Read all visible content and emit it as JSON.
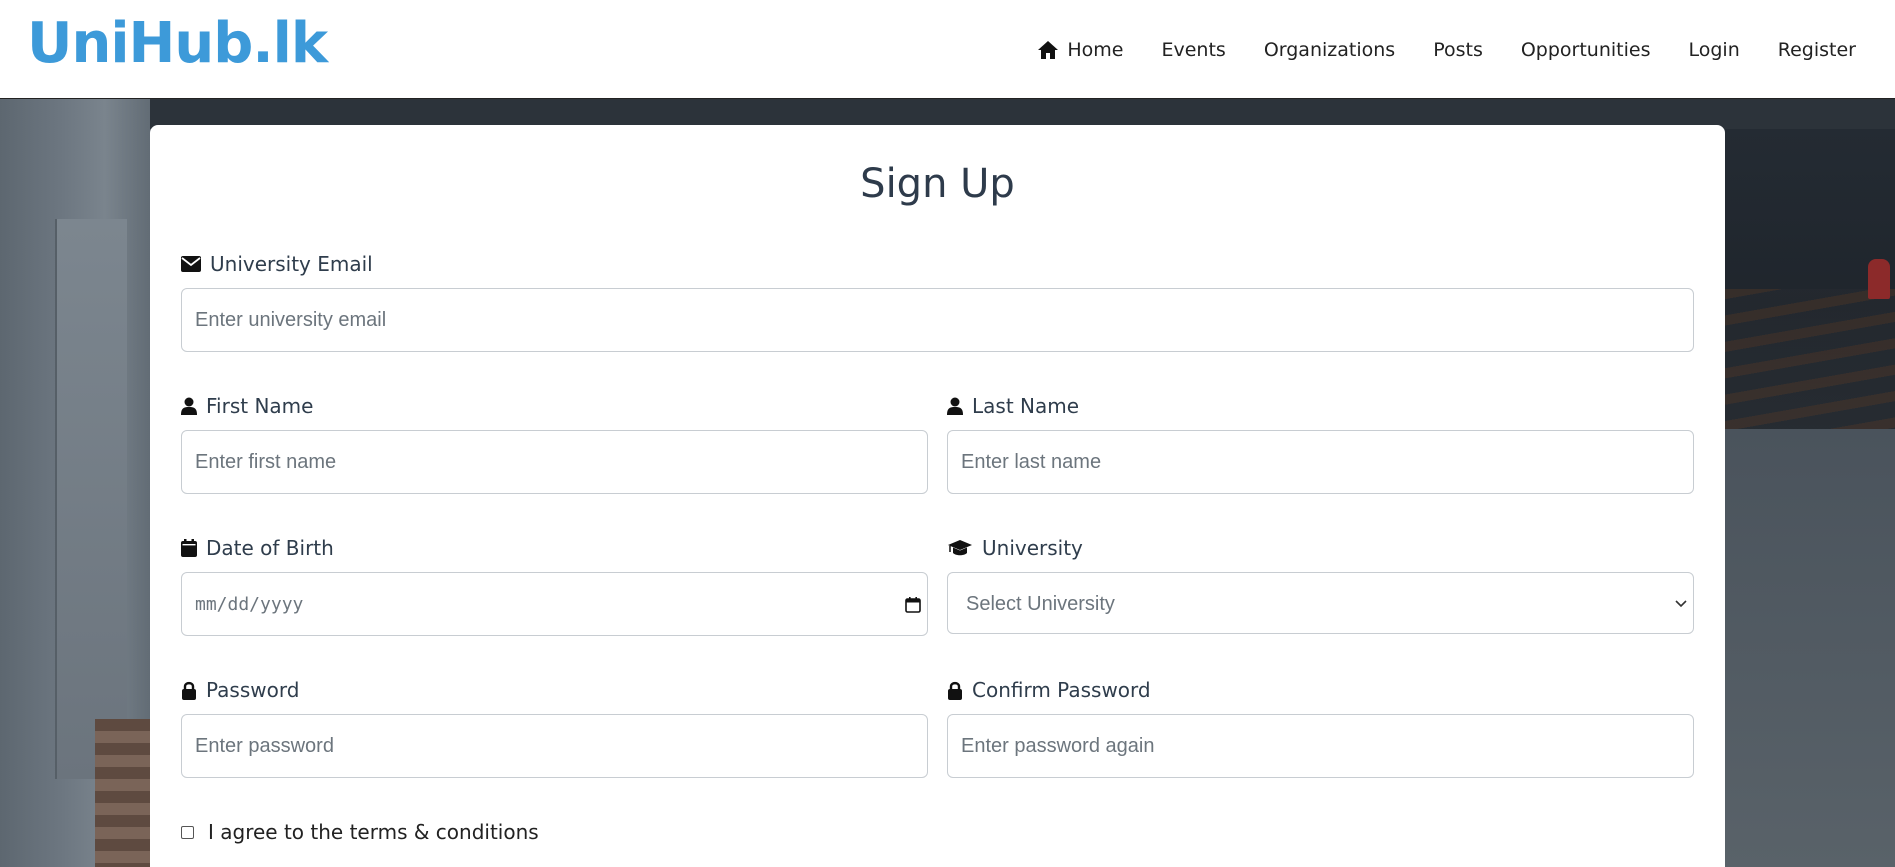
{
  "brand": {
    "name": "UniHub.lk",
    "color": "#3d9ad9"
  },
  "nav": {
    "items": [
      {
        "label": "Home",
        "icon": "home-icon"
      },
      {
        "label": "Events"
      },
      {
        "label": "Organizations"
      },
      {
        "label": "Posts"
      },
      {
        "label": "Opportunities"
      },
      {
        "label": "Login"
      },
      {
        "label": "Register"
      }
    ]
  },
  "form": {
    "title": "Sign Up",
    "email": {
      "label": "University Email",
      "icon": "envelope-icon",
      "placeholder": "Enter university email"
    },
    "first_name": {
      "label": "First Name",
      "icon": "user-icon",
      "placeholder": "Enter first name"
    },
    "last_name": {
      "label": "Last Name",
      "icon": "user-icon",
      "placeholder": "Enter last name"
    },
    "dob": {
      "label": "Date of Birth",
      "icon": "calendar-icon",
      "placeholder": "mm/dd/yyyy"
    },
    "university": {
      "label": "University",
      "icon": "graduation-cap-icon",
      "selected": "Select University"
    },
    "password": {
      "label": "Password",
      "icon": "lock-icon",
      "placeholder": "Enter password"
    },
    "confirm_password": {
      "label": "Confirm Password",
      "icon": "lock-icon",
      "placeholder": "Enter password again"
    },
    "terms": {
      "label": "I agree to the terms & conditions",
      "checked": false
    }
  }
}
